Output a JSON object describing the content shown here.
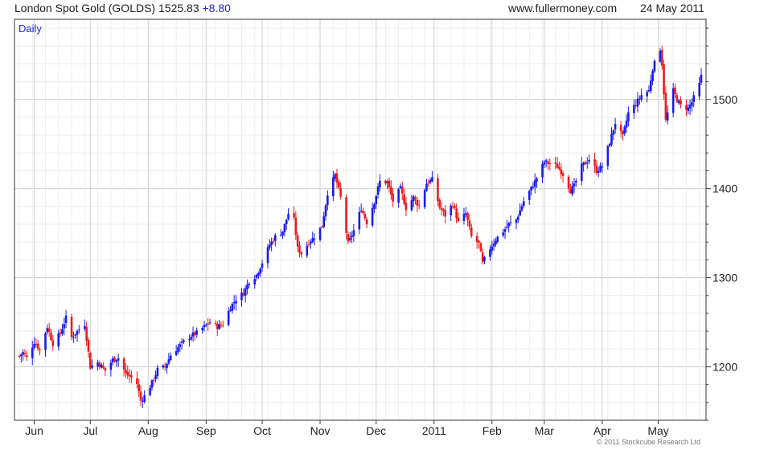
{
  "header": {
    "title": "London Spot Gold (GOLDS)",
    "price": "1525.83",
    "change": "+8.80",
    "site": "www.fullermoney.com",
    "date": "24 May 2011"
  },
  "copyright": "© 2011 Stockcube Research Ltd",
  "colors": {
    "up": "#1a1aee",
    "down": "#ee1a1a",
    "grid": "#dcdcdc",
    "accent": "#1f2bd6"
  },
  "chart_data": {
    "type": "candlestick",
    "period": "Daily",
    "title": "London Spot Gold (GOLDS)",
    "ylim": [
      1140,
      1590
    ],
    "yticks": [
      1200,
      1300,
      1400,
      1500
    ],
    "grid": true,
    "y_axis_side": "right",
    "x_tick_labels": [
      "Jun",
      "Jul",
      "Aug",
      "Sep",
      "Oct",
      "Nov",
      "Dec",
      "2011",
      "Feb",
      "Mar",
      "Apr",
      "May"
    ],
    "x_range": [
      "2010-05-24",
      "2011-05-24"
    ],
    "x_tick_dates": [
      "2010-06-01",
      "2010-07-01",
      "2010-08-01",
      "2010-09-01",
      "2010-10-01",
      "2010-11-01",
      "2010-12-01",
      "2011-01-01",
      "2011-02-01",
      "2011-03-01",
      "2011-04-01",
      "2011-05-01"
    ],
    "close_series": [
      {
        "date": "2010-05-24",
        "close": 1212
      },
      {
        "date": "2010-05-26",
        "close": 1216
      },
      {
        "date": "2010-05-28",
        "close": 1210
      },
      {
        "date": "2010-06-01",
        "close": 1228
      },
      {
        "date": "2010-06-04",
        "close": 1219
      },
      {
        "date": "2010-06-08",
        "close": 1245
      },
      {
        "date": "2010-06-11",
        "close": 1226
      },
      {
        "date": "2010-06-15",
        "close": 1238
      },
      {
        "date": "2010-06-18",
        "close": 1255
      },
      {
        "date": "2010-06-21",
        "close": 1233
      },
      {
        "date": "2010-06-25",
        "close": 1242
      },
      {
        "date": "2010-06-28",
        "close": 1248
      },
      {
        "date": "2010-07-01",
        "close": 1200
      },
      {
        "date": "2010-07-05",
        "close": 1205
      },
      {
        "date": "2010-07-09",
        "close": 1196
      },
      {
        "date": "2010-07-13",
        "close": 1208
      },
      {
        "date": "2010-07-16",
        "close": 1210
      },
      {
        "date": "2010-07-20",
        "close": 1192
      },
      {
        "date": "2010-07-23",
        "close": 1188
      },
      {
        "date": "2010-07-26",
        "close": 1181
      },
      {
        "date": "2010-07-28",
        "close": 1162
      },
      {
        "date": "2010-07-30",
        "close": 1167
      },
      {
        "date": "2010-08-03",
        "close": 1182
      },
      {
        "date": "2010-08-06",
        "close": 1197
      },
      {
        "date": "2010-08-10",
        "close": 1200
      },
      {
        "date": "2010-08-13",
        "close": 1213
      },
      {
        "date": "2010-08-17",
        "close": 1222
      },
      {
        "date": "2010-08-20",
        "close": 1228
      },
      {
        "date": "2010-08-24",
        "close": 1235
      },
      {
        "date": "2010-08-27",
        "close": 1238
      },
      {
        "date": "2010-08-31",
        "close": 1245
      },
      {
        "date": "2010-09-03",
        "close": 1250
      },
      {
        "date": "2010-09-07",
        "close": 1245
      },
      {
        "date": "2010-09-10",
        "close": 1248
      },
      {
        "date": "2010-09-14",
        "close": 1267
      },
      {
        "date": "2010-09-17",
        "close": 1276
      },
      {
        "date": "2010-09-21",
        "close": 1283
      },
      {
        "date": "2010-09-24",
        "close": 1296
      },
      {
        "date": "2010-09-28",
        "close": 1303
      },
      {
        "date": "2010-10-01",
        "close": 1317
      },
      {
        "date": "2010-10-05",
        "close": 1337
      },
      {
        "date": "2010-10-08",
        "close": 1346
      },
      {
        "date": "2010-10-12",
        "close": 1352
      },
      {
        "date": "2010-10-15",
        "close": 1372
      },
      {
        "date": "2010-10-18",
        "close": 1365
      },
      {
        "date": "2010-10-20",
        "close": 1333
      },
      {
        "date": "2010-10-22",
        "close": 1327
      },
      {
        "date": "2010-10-26",
        "close": 1340
      },
      {
        "date": "2010-10-29",
        "close": 1346
      },
      {
        "date": "2010-11-02",
        "close": 1358
      },
      {
        "date": "2010-11-05",
        "close": 1395
      },
      {
        "date": "2010-11-09",
        "close": 1415
      },
      {
        "date": "2010-11-12",
        "close": 1390
      },
      {
        "date": "2010-11-16",
        "close": 1338
      },
      {
        "date": "2010-11-19",
        "close": 1353
      },
      {
        "date": "2010-11-23",
        "close": 1378
      },
      {
        "date": "2010-11-26",
        "close": 1362
      },
      {
        "date": "2010-11-30",
        "close": 1385
      },
      {
        "date": "2010-12-03",
        "close": 1408
      },
      {
        "date": "2010-12-07",
        "close": 1407
      },
      {
        "date": "2010-12-10",
        "close": 1386
      },
      {
        "date": "2010-12-14",
        "close": 1400
      },
      {
        "date": "2010-12-17",
        "close": 1378
      },
      {
        "date": "2010-12-21",
        "close": 1390
      },
      {
        "date": "2010-12-24",
        "close": 1380
      },
      {
        "date": "2010-12-28",
        "close": 1406
      },
      {
        "date": "2010-12-31",
        "close": 1410
      },
      {
        "date": "2011-01-04",
        "close": 1379
      },
      {
        "date": "2011-01-07",
        "close": 1370
      },
      {
        "date": "2011-01-11",
        "close": 1383
      },
      {
        "date": "2011-01-14",
        "close": 1362
      },
      {
        "date": "2011-01-18",
        "close": 1372
      },
      {
        "date": "2011-01-21",
        "close": 1346
      },
      {
        "date": "2011-01-25",
        "close": 1338
      },
      {
        "date": "2011-01-27",
        "close": 1316
      },
      {
        "date": "2011-01-31",
        "close": 1333
      },
      {
        "date": "2011-02-03",
        "close": 1343
      },
      {
        "date": "2011-02-07",
        "close": 1352
      },
      {
        "date": "2011-02-10",
        "close": 1360
      },
      {
        "date": "2011-02-14",
        "close": 1365
      },
      {
        "date": "2011-02-18",
        "close": 1386
      },
      {
        "date": "2011-02-22",
        "close": 1400
      },
      {
        "date": "2011-02-25",
        "close": 1412
      },
      {
        "date": "2011-03-01",
        "close": 1430
      },
      {
        "date": "2011-03-04",
        "close": 1428
      },
      {
        "date": "2011-03-08",
        "close": 1425
      },
      {
        "date": "2011-03-11",
        "close": 1416
      },
      {
        "date": "2011-03-15",
        "close": 1398
      },
      {
        "date": "2011-03-17",
        "close": 1403
      },
      {
        "date": "2011-03-21",
        "close": 1425
      },
      {
        "date": "2011-03-25",
        "close": 1433
      },
      {
        "date": "2011-03-29",
        "close": 1420
      },
      {
        "date": "2011-04-01",
        "close": 1425
      },
      {
        "date": "2011-04-05",
        "close": 1452
      },
      {
        "date": "2011-04-08",
        "close": 1474
      },
      {
        "date": "2011-04-12",
        "close": 1458
      },
      {
        "date": "2011-04-15",
        "close": 1485
      },
      {
        "date": "2011-04-19",
        "close": 1495
      },
      {
        "date": "2011-04-22",
        "close": 1505
      },
      {
        "date": "2011-04-26",
        "close": 1510
      },
      {
        "date": "2011-04-28",
        "close": 1535
      },
      {
        "date": "2011-05-02",
        "close": 1557
      },
      {
        "date": "2011-05-03",
        "close": 1540
      },
      {
        "date": "2011-05-05",
        "close": 1476
      },
      {
        "date": "2011-05-09",
        "close": 1510
      },
      {
        "date": "2011-05-11",
        "close": 1500
      },
      {
        "date": "2011-05-13",
        "close": 1493
      },
      {
        "date": "2011-05-17",
        "close": 1490
      },
      {
        "date": "2011-05-19",
        "close": 1497
      },
      {
        "date": "2011-05-23",
        "close": 1517
      },
      {
        "date": "2011-05-24",
        "close": 1526
      }
    ]
  }
}
